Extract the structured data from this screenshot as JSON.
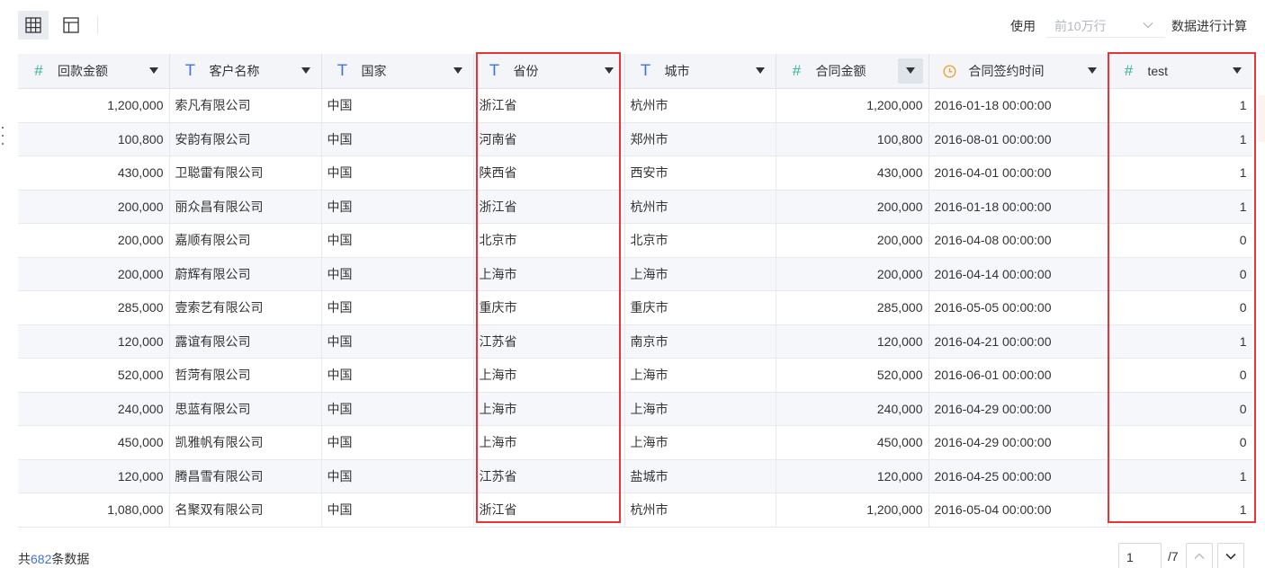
{
  "toolbar": {
    "use_label": "使用",
    "row_limit_value": "前10万行",
    "calc_label": "数据进行计算"
  },
  "columns": [
    {
      "label": "回款金额",
      "type": "number"
    },
    {
      "label": "客户名称",
      "type": "text"
    },
    {
      "label": "国家",
      "type": "text"
    },
    {
      "label": "省份",
      "type": "text"
    },
    {
      "label": "城市",
      "type": "text"
    },
    {
      "label": "合同金额",
      "type": "number"
    },
    {
      "label": "合同签约时间",
      "type": "datetime"
    },
    {
      "label": "test",
      "type": "number"
    }
  ],
  "rows": [
    [
      "1,200,000",
      "索凡有限公司",
      "中国",
      "浙江省",
      "杭州市",
      "1,200,000",
      "2016-01-18 00:00:00",
      "1"
    ],
    [
      "100,800",
      "安韵有限公司",
      "中国",
      "河南省",
      "郑州市",
      "100,800",
      "2016-08-01 00:00:00",
      "1"
    ],
    [
      "430,000",
      "卫聪雷有限公司",
      "中国",
      "陕西省",
      "西安市",
      "430,000",
      "2016-04-01 00:00:00",
      "1"
    ],
    [
      "200,000",
      "丽众昌有限公司",
      "中国",
      "浙江省",
      "杭州市",
      "200,000",
      "2016-01-18 00:00:00",
      "1"
    ],
    [
      "200,000",
      "嘉顺有限公司",
      "中国",
      "北京市",
      "北京市",
      "200,000",
      "2016-04-08 00:00:00",
      "0"
    ],
    [
      "200,000",
      "蔚辉有限公司",
      "中国",
      "上海市",
      "上海市",
      "200,000",
      "2016-04-14 00:00:00",
      "0"
    ],
    [
      "285,000",
      "壹索艺有限公司",
      "中国",
      "重庆市",
      "重庆市",
      "285,000",
      "2016-05-05 00:00:00",
      "0"
    ],
    [
      "120,000",
      "露谊有限公司",
      "中国",
      "江苏省",
      "南京市",
      "120,000",
      "2016-04-21 00:00:00",
      "1"
    ],
    [
      "520,000",
      "哲菏有限公司",
      "中国",
      "上海市",
      "上海市",
      "520,000",
      "2016-06-01 00:00:00",
      "0"
    ],
    [
      "240,000",
      "思蓝有限公司",
      "中国",
      "上海市",
      "上海市",
      "240,000",
      "2016-04-29 00:00:00",
      "0"
    ],
    [
      "450,000",
      "凯雅帆有限公司",
      "中国",
      "上海市",
      "上海市",
      "450,000",
      "2016-04-29 00:00:00",
      "0"
    ],
    [
      "120,000",
      "腾昌雪有限公司",
      "中国",
      "江苏省",
      "盐城市",
      "120,000",
      "2016-04-25 00:00:00",
      "1"
    ],
    [
      "1,080,000",
      "名聚双有限公司",
      "中国",
      "浙江省",
      "杭州市",
      "1,200,000",
      "2016-05-04 00:00:00",
      "1"
    ]
  ],
  "footer": {
    "prefix": "共",
    "count": "682",
    "suffix": "条数据",
    "current_page": "1",
    "total_pages": "/7"
  },
  "colors": {
    "highlight": "#e8333b",
    "number_icon": "#3bb39c",
    "text_icon": "#3d73e0",
    "date_icon": "#f0a030"
  }
}
